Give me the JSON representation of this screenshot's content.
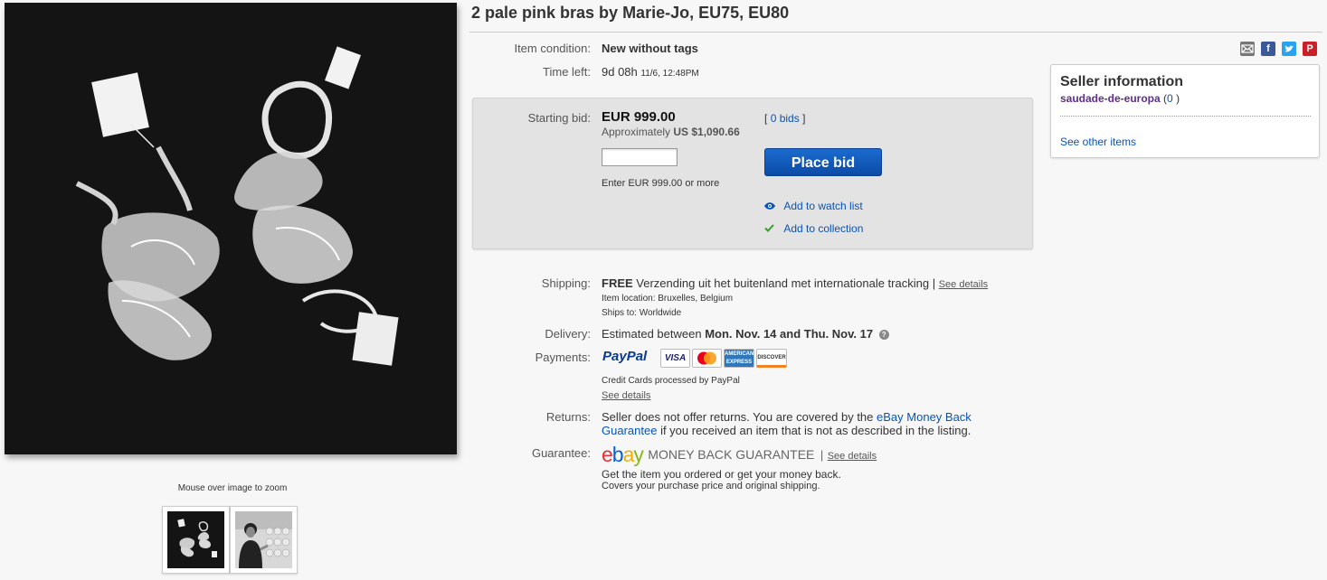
{
  "title": "2 pale pink bras by Marie-Jo, EU75, EU80",
  "gallery": {
    "zoom_hint": "Mouse over image to zoom",
    "thumbnails": [
      "bras-flatlay-thumb",
      "person-portrait-thumb"
    ]
  },
  "share_icons": [
    "email-icon",
    "facebook-icon",
    "twitter-icon",
    "pinterest-icon"
  ],
  "item": {
    "condition_label": "Item condition:",
    "condition_value": "New without tags",
    "time_left_label": "Time left:",
    "time_left_value": "9d 08h",
    "time_left_date": "11/6, 12:48PM"
  },
  "bid": {
    "starting_label": "Starting bid:",
    "price": "EUR 999.00",
    "approx_prefix": "Approximately",
    "approx_value": "US $1,090.66",
    "bids_open": "[",
    "bids_link": "0 bids",
    "bids_close": "]",
    "input_value": "",
    "hint": "Enter EUR 999.00 or more",
    "place_bid": "Place bid",
    "watch_list": "Add to watch list",
    "collection": "Add to collection"
  },
  "seller": {
    "heading": "Seller information",
    "name": "saudade-de-europa",
    "feedback_open": "(",
    "feedback": "0",
    "feedback_close": ")",
    "other_items": "See other items"
  },
  "shipping": {
    "label": "Shipping:",
    "free": "FREE",
    "method": "Verzending uit het buitenland met internationale tracking",
    "sep": "|",
    "details": "See details",
    "location_label": "Item location:",
    "location": "Bruxelles, Belgium",
    "ships_label": "Ships to:",
    "ships": "Worldwide"
  },
  "delivery": {
    "label": "Delivery:",
    "prefix": "Estimated between",
    "dates": "Mon. Nov. 14 and Thu. Nov. 17"
  },
  "payments": {
    "label": "Payments:",
    "paypal": "PayPal",
    "cards": [
      "VISA",
      "MasterCard",
      "AMERICAN EXPRESS",
      "DISCOVER"
    ],
    "processed": "Credit Cards processed by PayPal",
    "details": "See details"
  },
  "returns": {
    "label": "Returns:",
    "text1": "Seller does not offer returns. You are covered by the",
    "link": "eBay Money Back Guarantee",
    "text2": "if you received an item that is not as described in the listing."
  },
  "guarantee": {
    "label": "Guarantee:",
    "logo": "ebay",
    "mbg": "MONEY BACK GUARANTEE",
    "sep": "|",
    "details": "See details",
    "line1": "Get the item you ordered or get your money back.",
    "line2": "Covers your purchase price and original shipping."
  },
  "colors": {
    "link": "#0654ba",
    "button": "#0b4ba7",
    "seller_name": "#5e2d91",
    "check": "#3a9a2e"
  }
}
